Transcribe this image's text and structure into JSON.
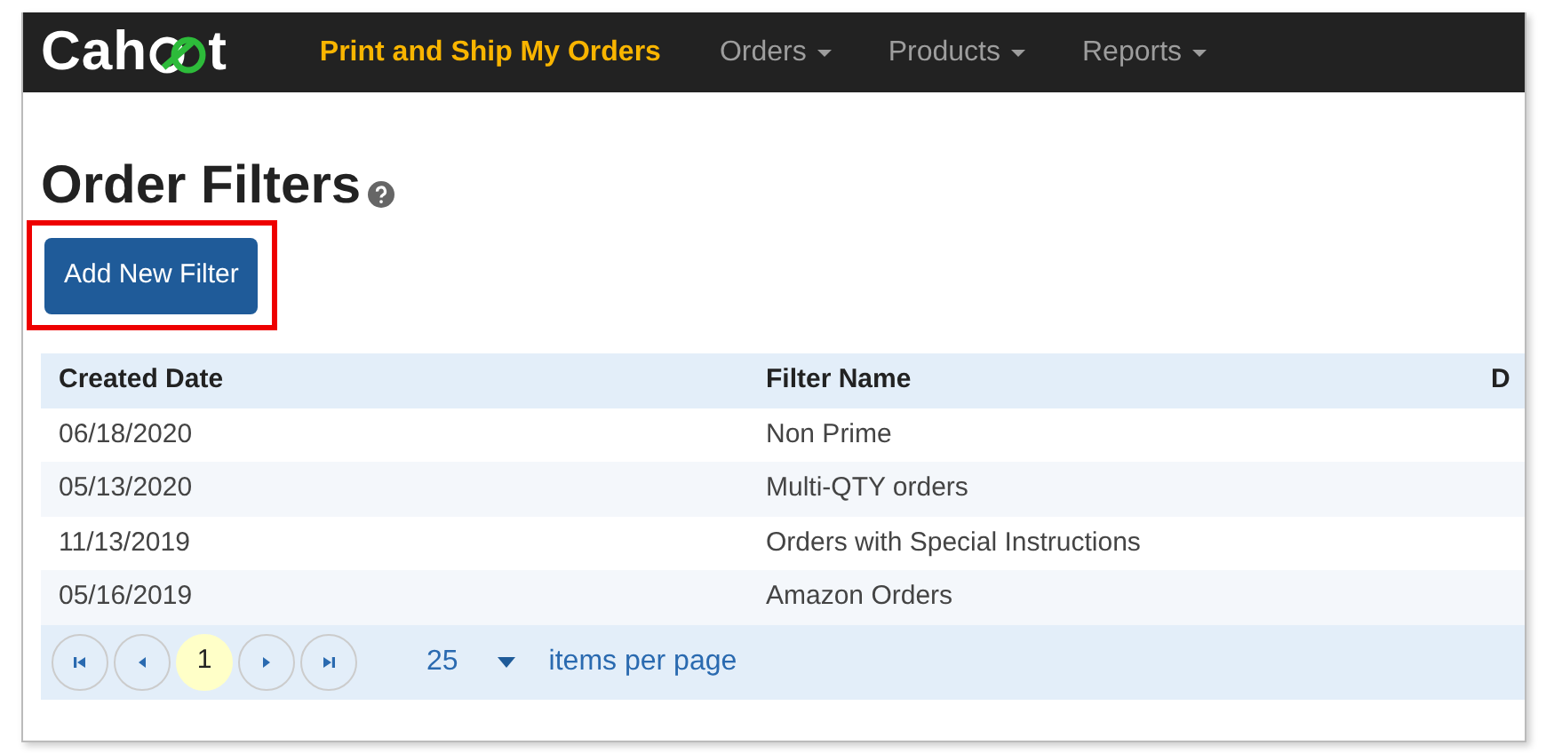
{
  "navbar": {
    "logo": {
      "before": "Cah",
      "after": "t"
    },
    "brand": "Print and Ship My Orders",
    "menus": [
      {
        "label": "Orders"
      },
      {
        "label": "Products"
      },
      {
        "label": "Reports"
      }
    ]
  },
  "page": {
    "title": "Order Filters",
    "add_button": {
      "label": "Add New Filter",
      "highlighted": true
    }
  },
  "table": {
    "columns": [
      "Created Date",
      "Filter Name",
      "D"
    ],
    "rows": [
      [
        "06/18/2020",
        "Non Prime"
      ],
      [
        "05/13/2020",
        "Multi-QTY orders"
      ],
      [
        "11/13/2019",
        "Orders with Special Instructions"
      ],
      [
        "05/16/2019",
        "Amazon Orders"
      ]
    ]
  },
  "pager": {
    "pages": [
      {
        "label": "1",
        "selected": true
      }
    ],
    "page_size": "25",
    "page_size_label": "items per page"
  }
}
